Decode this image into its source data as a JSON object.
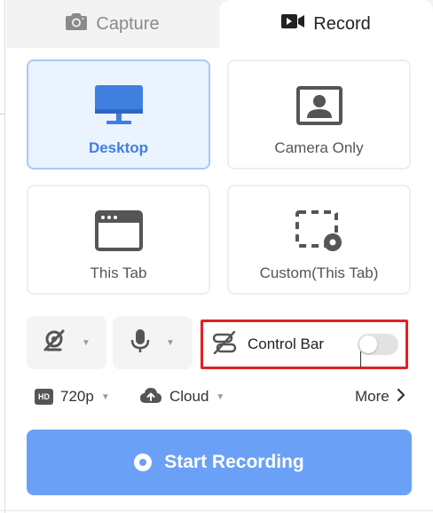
{
  "tabs": {
    "capture_label": "Capture",
    "record_label": "Record",
    "active": "record"
  },
  "modes": [
    {
      "label": "Desktop",
      "icon": "monitor-icon",
      "selected": true
    },
    {
      "label": "Camera Only",
      "icon": "camera-portrait-icon",
      "selected": false
    },
    {
      "label": "This Tab",
      "icon": "browser-tab-icon",
      "selected": false
    },
    {
      "label": "Custom(This Tab)",
      "icon": "custom-region-icon",
      "selected": false
    }
  ],
  "controls": {
    "camera_icon": "camera-off-icon",
    "mic_icon": "microphone-icon",
    "control_bar_label": "Control Bar",
    "control_bar_icon": "control-bar-off-icon",
    "control_bar_enabled": false
  },
  "options": {
    "resolution_badge": "HD",
    "resolution": "720p",
    "storage": "Cloud",
    "more": "More"
  },
  "start_button_label": "Start Recording",
  "colors": {
    "accent": "#3f7fe0",
    "start_button": "#6aa1f7",
    "selected_card_bg": "#ebf3ff",
    "highlight_border": "#e32020"
  }
}
